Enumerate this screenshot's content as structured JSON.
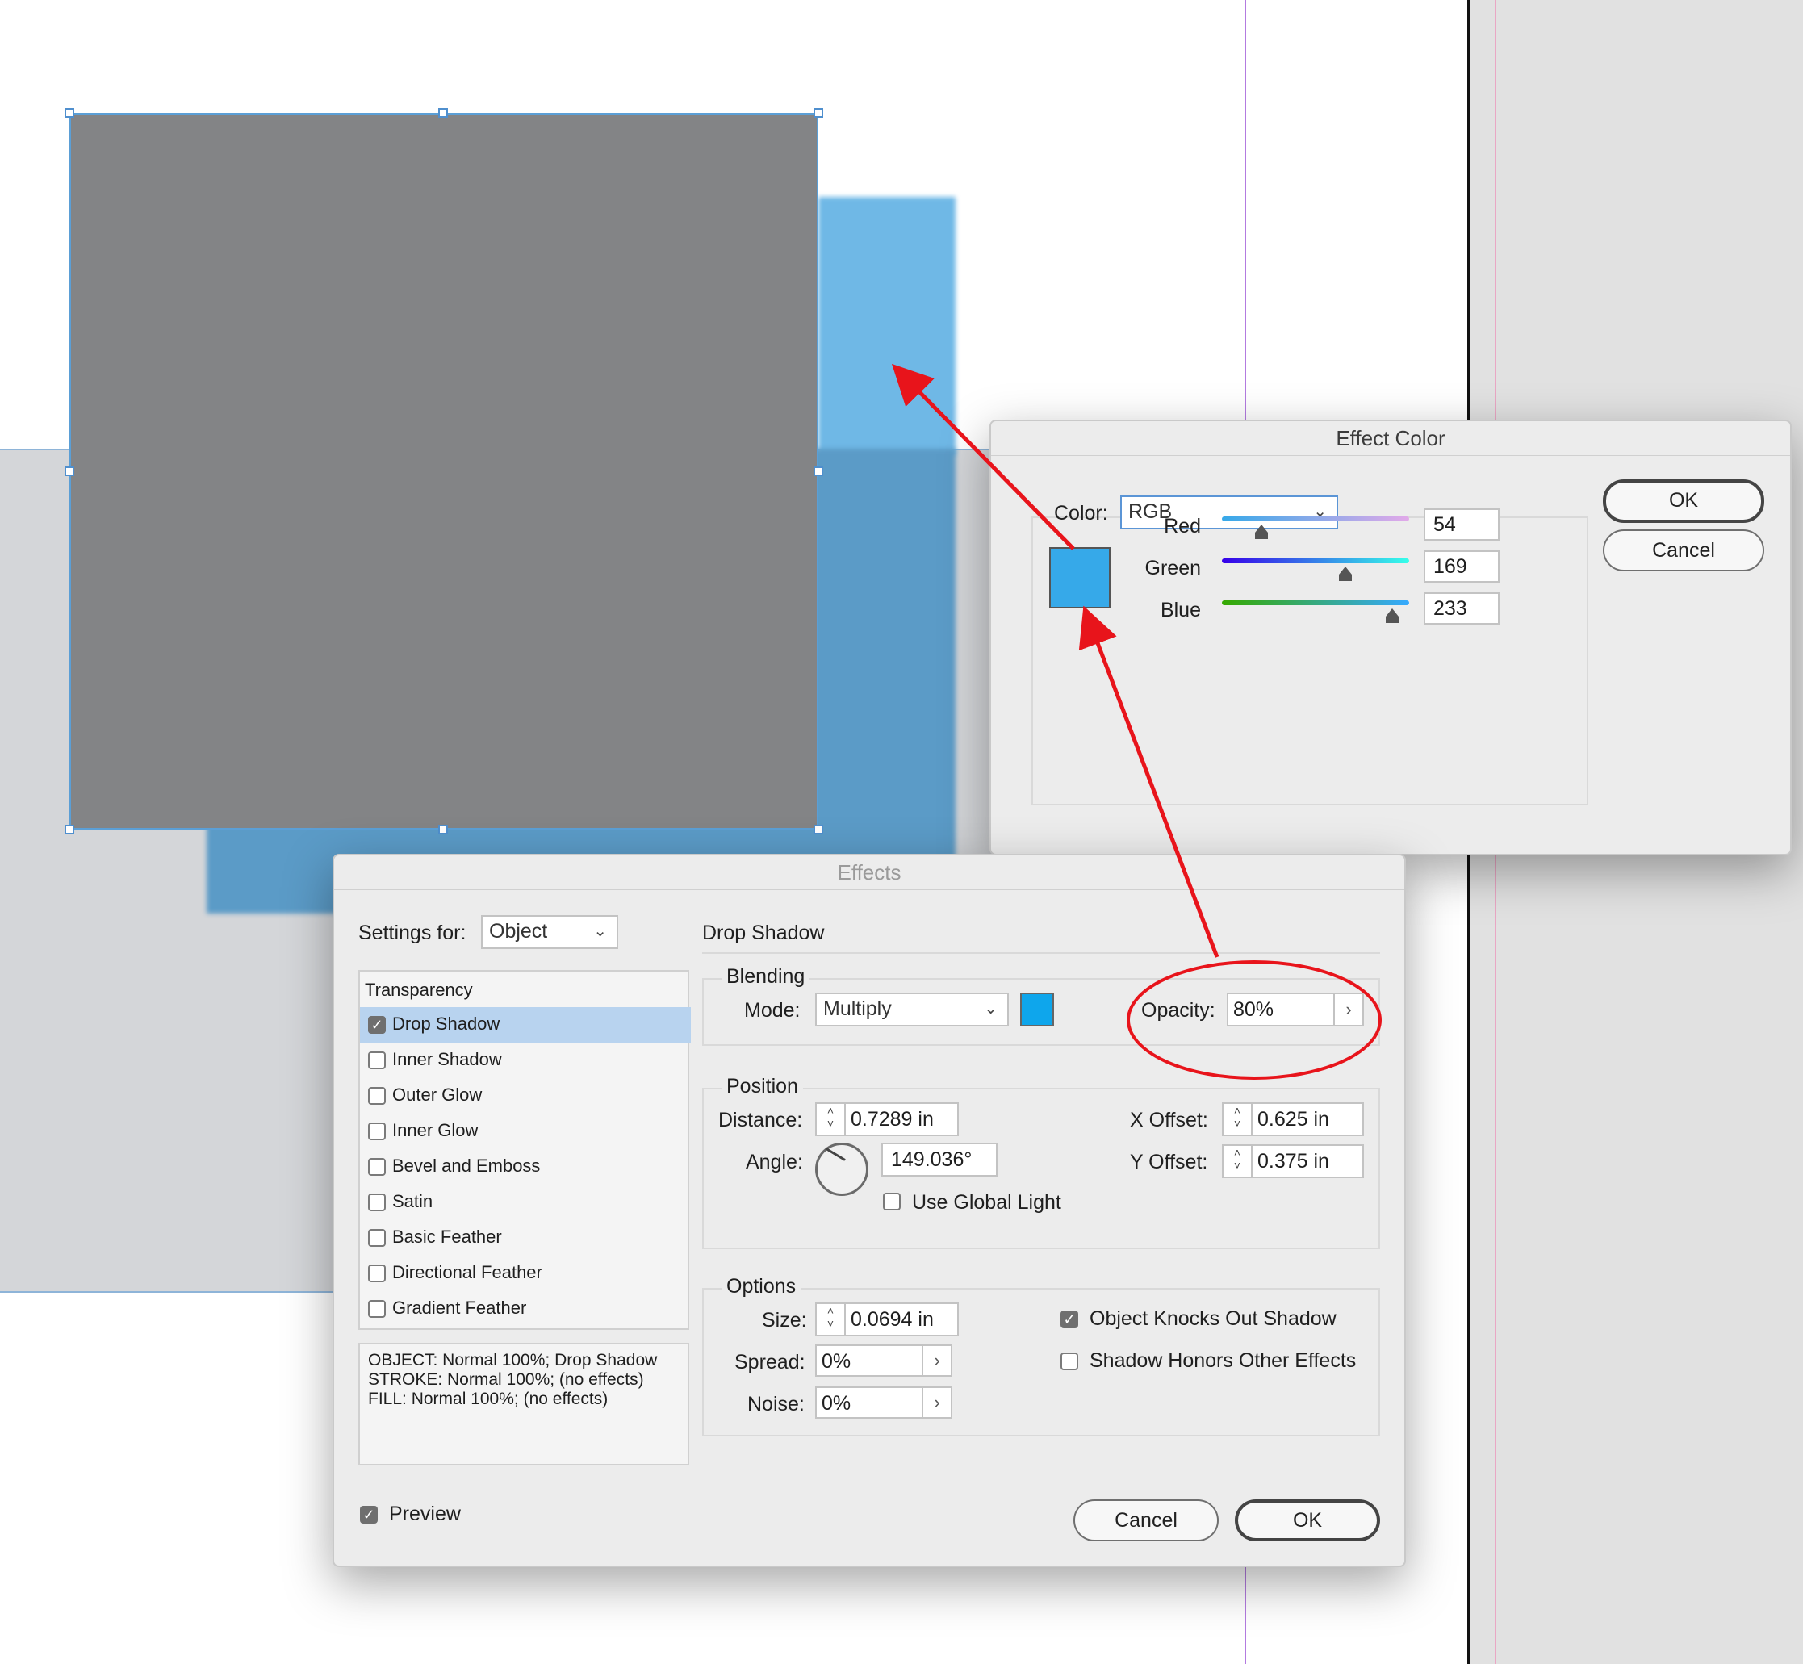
{
  "effect_color": {
    "title": "Effect Color",
    "color_label": "Color:",
    "color_mode": "RGB",
    "swatch_color": "#36a9e9",
    "channels": [
      {
        "label": "Red",
        "value": "54",
        "fraction": 0.21
      },
      {
        "label": "Green",
        "value": "169",
        "fraction": 0.66
      },
      {
        "label": "Blue",
        "value": "233",
        "fraction": 0.91
      }
    ],
    "ok_label": "OK",
    "cancel_label": "Cancel"
  },
  "effects": {
    "title": "Effects",
    "settings_for_label": "Settings for:",
    "settings_for_value": "Object",
    "list_header": "Transparency",
    "effects_list": [
      {
        "label": "Drop Shadow",
        "checked": true,
        "selected": true
      },
      {
        "label": "Inner Shadow",
        "checked": false
      },
      {
        "label": "Outer Glow",
        "checked": false
      },
      {
        "label": "Inner Glow",
        "checked": false
      },
      {
        "label": "Bevel and Emboss",
        "checked": false
      },
      {
        "label": "Satin",
        "checked": false
      },
      {
        "label": "Basic Feather",
        "checked": false
      },
      {
        "label": "Directional Feather",
        "checked": false
      },
      {
        "label": "Gradient Feather",
        "checked": false
      }
    ],
    "summary": [
      "OBJECT: Normal 100%; Drop Shadow",
      "STROKE: Normal 100%; (no effects)",
      "FILL: Normal 100%; (no effects)"
    ],
    "preview_label": "Preview",
    "preview_checked": true,
    "section_title": "Drop Shadow",
    "blending": {
      "group_label": "Blending",
      "mode_label": "Mode:",
      "mode_value": "Multiply",
      "swatch_color": "#0ea6ec",
      "opacity_label": "Opacity:",
      "opacity_value": "80%"
    },
    "position": {
      "group_label": "Position",
      "distance_label": "Distance:",
      "distance_value": "0.7289 in",
      "angle_label": "Angle:",
      "angle_value": "149.036°",
      "use_global_light_label": "Use Global Light",
      "x_offset_label": "X Offset:",
      "x_offset_value": "0.625 in",
      "y_offset_label": "Y Offset:",
      "y_offset_value": "0.375 in"
    },
    "options": {
      "group_label": "Options",
      "size_label": "Size:",
      "size_value": "0.0694 in",
      "spread_label": "Spread:",
      "spread_value": "0%",
      "noise_label": "Noise:",
      "noise_value": "0%",
      "knocks_out_label": "Object Knocks Out Shadow",
      "knocks_out_checked": true,
      "honors_label": "Shadow Honors Other Effects",
      "honors_checked": false
    },
    "cancel_label": "Cancel",
    "ok_label": "OK"
  },
  "annotation_color": "#e8141b"
}
